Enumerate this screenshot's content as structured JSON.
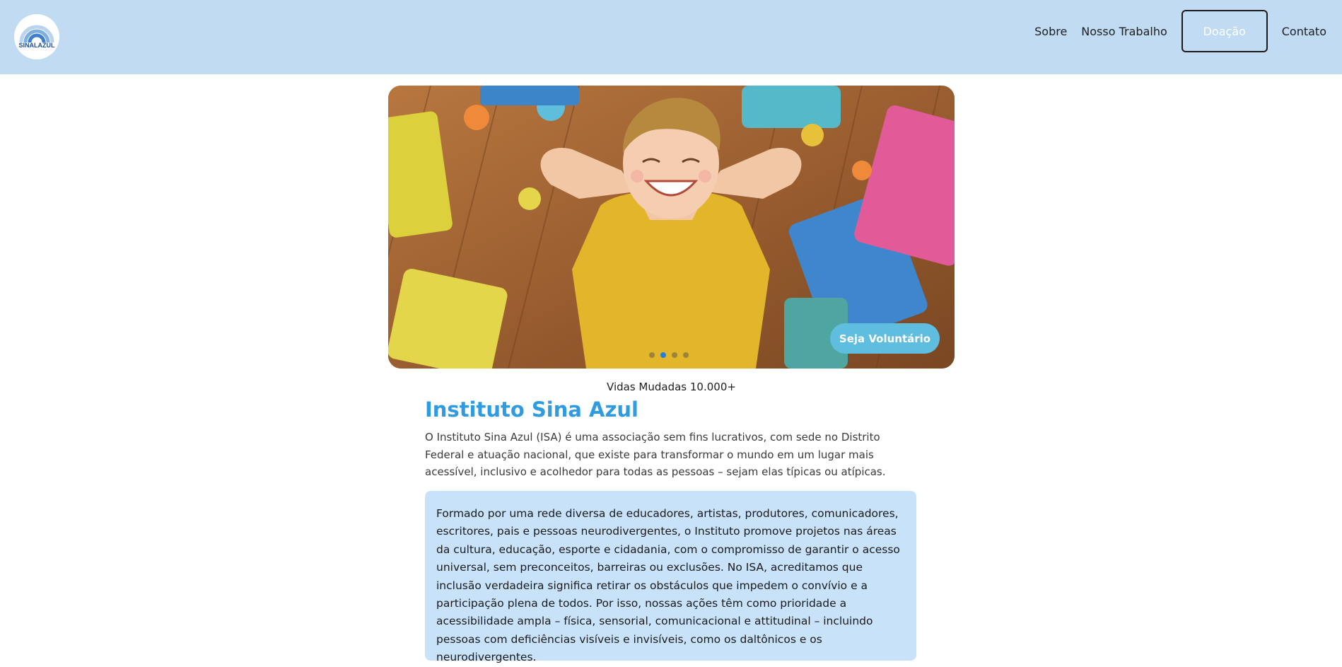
{
  "header": {
    "logo_text": "SINALAZUL",
    "nav": {
      "about": "Sobre",
      "our_work": "Nosso Trabalho",
      "donate": "Doação",
      "contact": "Contato"
    }
  },
  "hero": {
    "image_description": "smiling-child-on-puzzle-mat",
    "volunteer_button": "Seja Voluntário",
    "slides_total": 4,
    "active_slide": 2
  },
  "stats": {
    "lives_changed": "Vidas Mudadas 10.000+"
  },
  "about": {
    "title": "Instituto Sina Azul",
    "intro": "O Instituto Sina Azul (ISA) é uma associação sem fins lucrativos, com sede no Distrito Federal e atuação nacional, que existe para transformar o mundo em um lugar mais acessível, inclusivo e acolhedor para todas as pessoas – sejam elas típicas ou atípicas.",
    "highlight": "Formado por uma rede diversa de educadores, artistas, produtores, comunicadores, escritores, pais e pessoas neurodivergentes, o Instituto promove projetos nas áreas da cultura, educação, esporte e cidadania, com o compromisso de garantir o acesso universal, sem preconceitos, barreiras ou exclusões. No ISA, acreditamos que inclusão verdadeira significa retirar os obstáculos que impedem o convívio e a participação plena de todos. Por isso, nossas ações têm como prioridade a acessibilidade ampla – física, sensorial, comunicacional e attitudinal – incluindo pessoas com deficiências visíveis e invisíveis, como os daltônicos e os neurodivergentes."
  },
  "colors": {
    "header_bg": "#c0dbf2",
    "title": "#2f9be0",
    "volunteer_button": "#5fbde0",
    "highlight_bg": "#c8e2fa",
    "active_dot": "#1f7fe0"
  }
}
